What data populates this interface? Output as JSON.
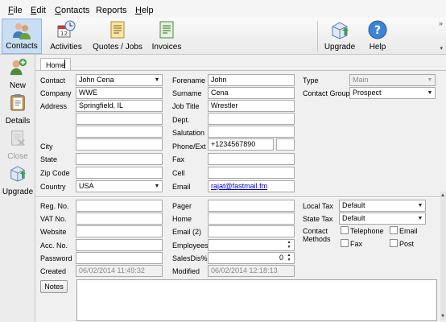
{
  "menu": [
    {
      "label": "File",
      "u": "F",
      "rest": "ile"
    },
    {
      "label": "Edit",
      "u": "E",
      "rest": "dit"
    },
    {
      "label": "Contacts",
      "u": "C",
      "rest": "ontacts"
    },
    {
      "label": "Reports",
      "u": "",
      "rest": "Reports"
    },
    {
      "label": "Help",
      "u": "H",
      "rest": "elp"
    }
  ],
  "toolbar": {
    "contacts": "Contacts",
    "activities": "Activities",
    "quotes": "Quotes / Jobs",
    "invoices": "Invoices",
    "upgrade": "Upgrade",
    "help": "Help",
    "overflow": "»",
    "dropdown": "▾"
  },
  "sidebar": {
    "new": "New",
    "details": "Details",
    "close": "Close",
    "upgrade": "Upgrade"
  },
  "tab": {
    "home": "Home"
  },
  "labels": {
    "contact": "Contact",
    "company": "Company",
    "address": "Address",
    "city": "City",
    "state": "State",
    "zip": "Zip Code",
    "country": "Country",
    "forename": "Forename",
    "surname": "Surname",
    "job_title": "Job Title",
    "dept": "Dept.",
    "salutation": "Salutation",
    "phone": "Phone/Ext",
    "fax": "Fax",
    "cell": "Cell",
    "email": "Email",
    "type": "Type",
    "contact_group": "Contact Group",
    "reg_no": "Reg. No.",
    "vat_no": "VAT No.",
    "website": "Website",
    "acc_no": "Acc. No.",
    "password": "Password",
    "created": "Created",
    "pager": "Pager",
    "home": "Home",
    "email2": "Email (2)",
    "employees": "Employees",
    "sales_dis": "SalesDis%",
    "modified": "Modified",
    "local_tax": "Local Tax",
    "state_tax": "State Tax",
    "contact_methods_1": "Contact",
    "contact_methods_2": "Methods",
    "cm_telephone": "Telephone",
    "cm_email": "Email",
    "cm_fax": "Fax",
    "cm_post": "Post"
  },
  "values": {
    "contact": "John Cena",
    "company": "WWE",
    "address1": "Springfield, IL",
    "address2": "",
    "address3": "",
    "address4": "",
    "city": "",
    "state": "",
    "zip": "",
    "country": "USA",
    "forename": "John",
    "surname": "Cena",
    "job_title": "Wrestler",
    "dept": "",
    "salutation": "",
    "phone": "+1234567890",
    "ext": "",
    "fax": "",
    "cell": "",
    "email": "rajat@fastmail.fm",
    "type": "Main",
    "contact_group": "Prospect",
    "reg_no": "",
    "vat_no": "",
    "website": "",
    "acc_no": "",
    "password": "",
    "created": "06/02/2014 11:49:32",
    "pager": "",
    "home": "",
    "email2": "",
    "employees": "",
    "sales_dis": "0",
    "modified": "06/02/2014 12:18:13",
    "local_tax": "Default",
    "state_tax": "Default"
  },
  "buttons": {
    "notes": "Notes"
  },
  "glyphs": {
    "dropdown": "▼",
    "spin_up": "▲",
    "spin_down": "▼",
    "scroll_up": "▲",
    "scroll_down": "▼"
  },
  "icons": {
    "contacts": "people-icon",
    "activities": "calendar-clock-icon",
    "quotes": "document-list-icon",
    "invoices": "invoice-icon",
    "upgrade": "upgrade-box-icon",
    "help": "help-icon",
    "new": "add-person-icon",
    "details": "clipboard-icon",
    "close": "close-document-icon"
  }
}
